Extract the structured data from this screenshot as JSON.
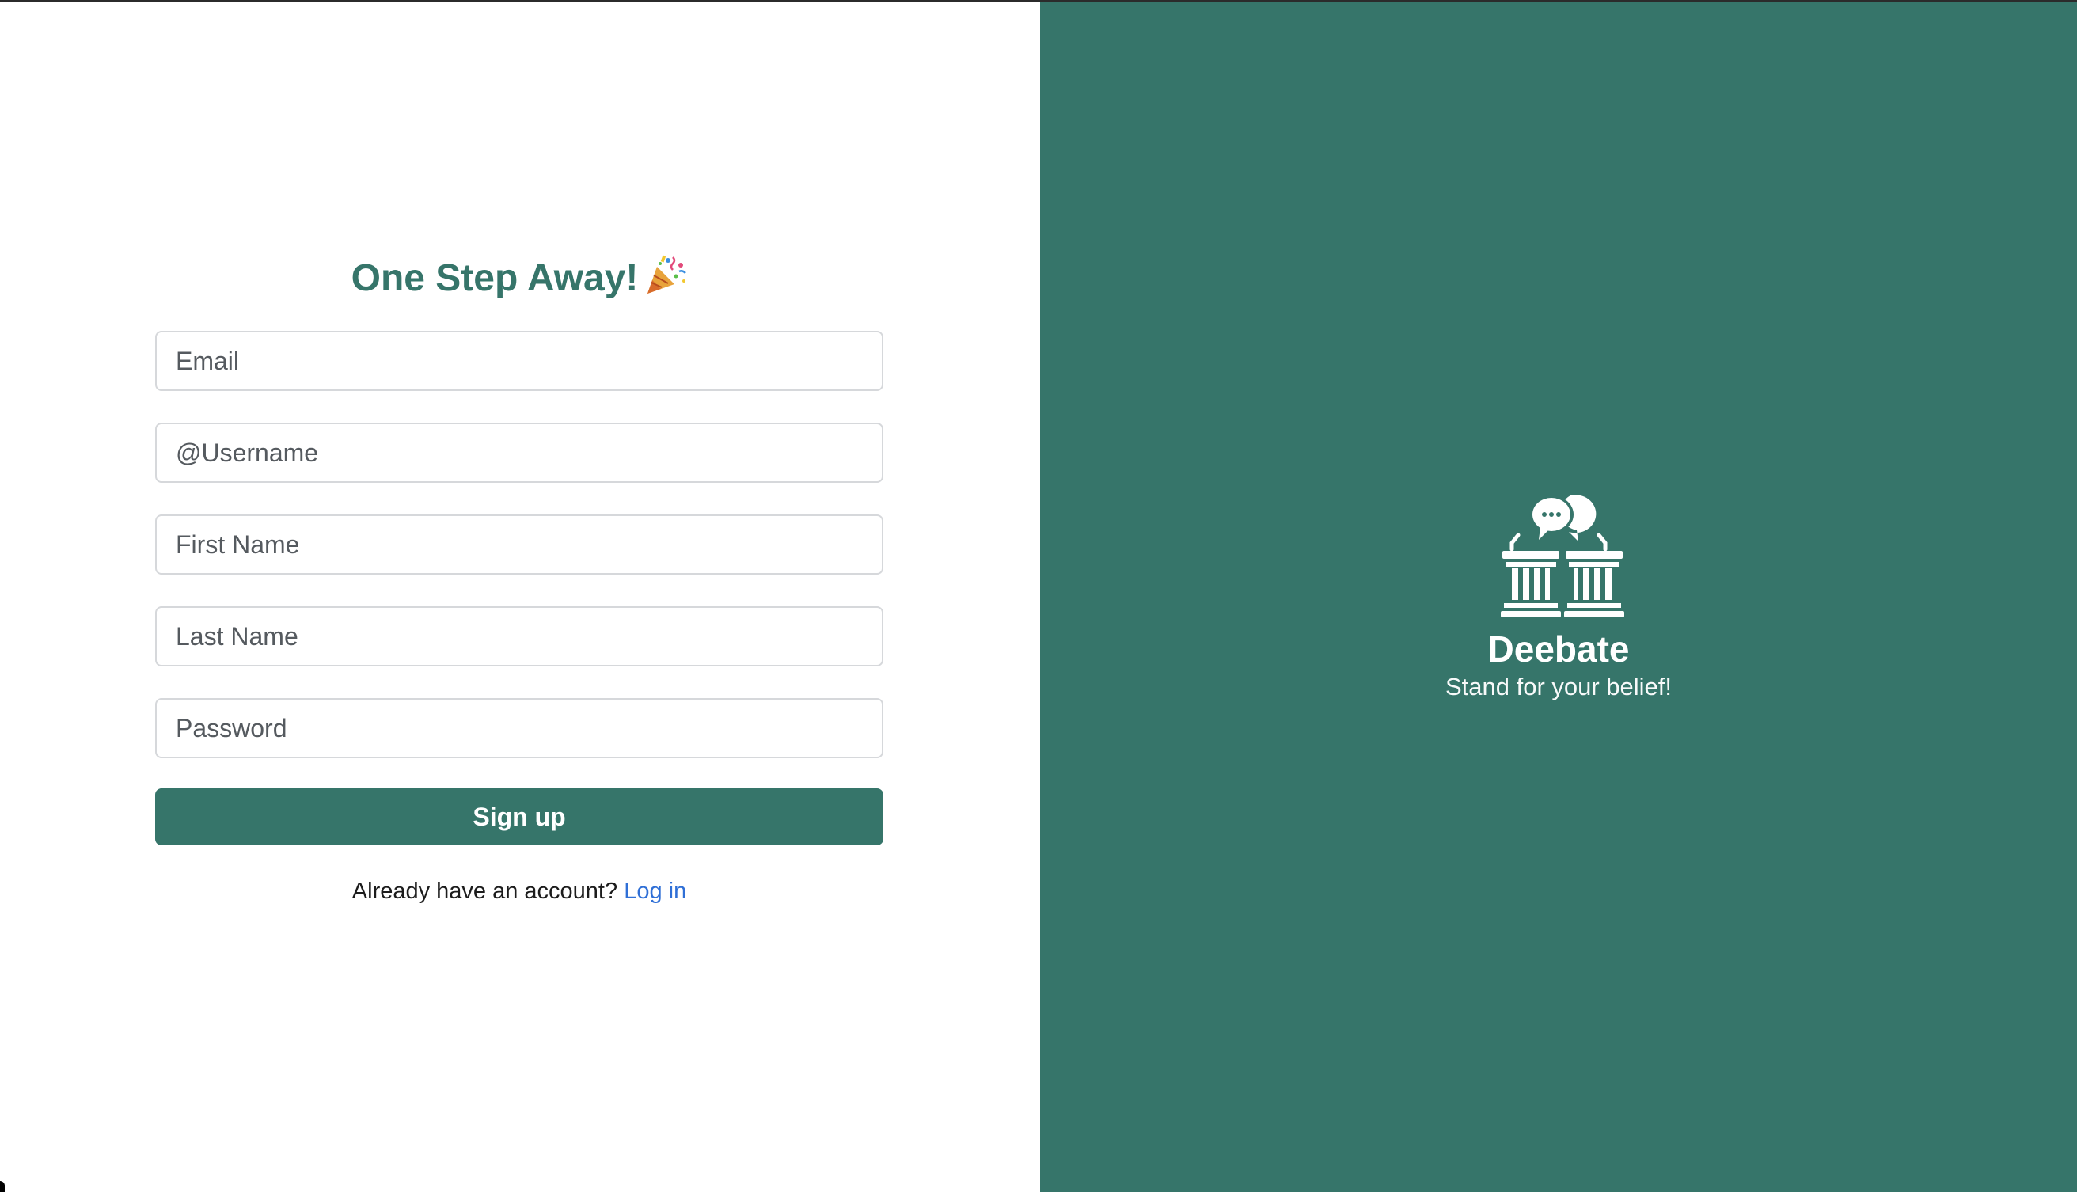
{
  "signup": {
    "title": "One Step Away!",
    "title_icon": "party-popper-icon",
    "fields": {
      "email_placeholder": "Email",
      "username_placeholder": "@Username",
      "first_name_placeholder": "First Name",
      "last_name_placeholder": "Last Name",
      "password_placeholder": "Password"
    },
    "submit_label": "Sign up",
    "login_prompt": "Already have an account?",
    "login_link_label": "Log in"
  },
  "brand": {
    "icon": "debate-podiums-icon",
    "name": "Deebate",
    "tagline": "Stand for your belief!"
  },
  "colors": {
    "brand_green": "#36756a",
    "link_blue": "#2f6fd6"
  }
}
